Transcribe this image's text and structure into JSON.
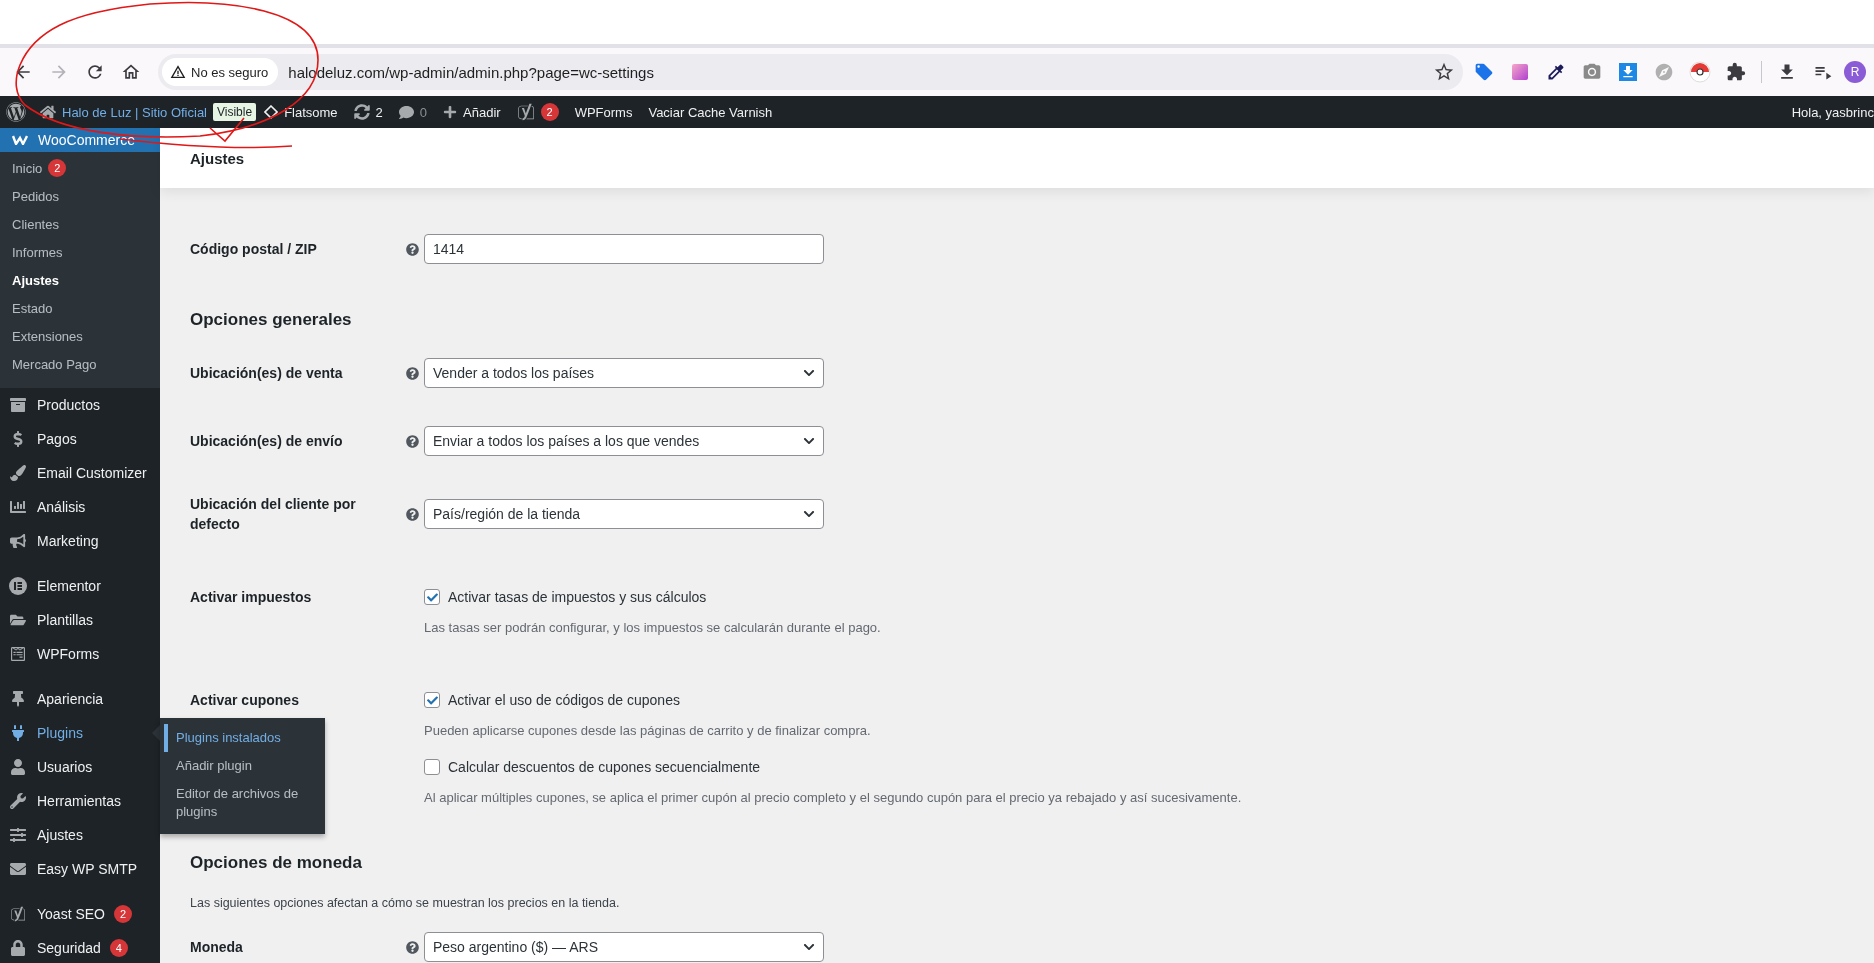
{
  "browser": {
    "back_disabled": false,
    "forward_disabled": true,
    "security_label": "No es seguro",
    "url": "halodeluz.com/wp-admin/admin.php?page=wc-settings",
    "profile_letter": "R"
  },
  "admin_bar": {
    "site_name": "Halo de Luz | Sitio Oficial",
    "visibility_badge": "Visible",
    "items": [
      {
        "kind": "theme",
        "label": "Flatsome"
      },
      {
        "kind": "updates",
        "label": "2"
      },
      {
        "kind": "comments",
        "label": "0"
      },
      {
        "kind": "new",
        "label": "Añadir"
      },
      {
        "kind": "seo",
        "badge": "2"
      },
      {
        "kind": "text",
        "label": "WPForms"
      },
      {
        "kind": "text",
        "label": "Vaciar Cache Varnish"
      }
    ],
    "greeting": "Hola, yasbrinc"
  },
  "sidebar": {
    "items": [
      {
        "kind": "woo",
        "label": "WooCommerce",
        "current": true,
        "children": [
          {
            "label": "Inicio",
            "badge": "2",
            "selected": false
          },
          {
            "label": "Pedidos",
            "selected": false
          },
          {
            "label": "Clientes",
            "selected": false
          },
          {
            "label": "Informes",
            "selected": false
          },
          {
            "label": "Ajustes",
            "selected": true
          },
          {
            "label": "Estado",
            "selected": false
          },
          {
            "label": "Extensiones",
            "selected": false
          },
          {
            "label": "Mercado Pago",
            "selected": false
          }
        ]
      },
      {
        "kind": "products",
        "label": "Productos"
      },
      {
        "kind": "payments",
        "label": "Pagos"
      },
      {
        "kind": "brush",
        "label": "Email Customizer"
      },
      {
        "kind": "analytics",
        "label": "Análisis"
      },
      {
        "kind": "marketing",
        "label": "Marketing"
      },
      {
        "kind": "elementor",
        "label": "Elementor",
        "separator_before": true
      },
      {
        "kind": "templates",
        "label": "Plantillas"
      },
      {
        "kind": "forms",
        "label": "WPForms"
      },
      {
        "kind": "appearance",
        "label": "Apariencia",
        "separator_before": true
      },
      {
        "kind": "plugins",
        "label": "Plugins",
        "hovered": true,
        "flyout": [
          {
            "label": "Plugins instalados",
            "selected": true
          },
          {
            "label": "Añadir plugin",
            "selected": false
          },
          {
            "label": "Editor de archivos de plugins",
            "selected": false
          }
        ]
      },
      {
        "kind": "users",
        "label": "Usuarios"
      },
      {
        "kind": "tools",
        "label": "Herramientas"
      },
      {
        "kind": "settings",
        "label": "Ajustes"
      },
      {
        "kind": "mail",
        "label": "Easy WP SMTP"
      },
      {
        "kind": "seo",
        "label": "Yoast SEO",
        "badge": "2",
        "separator_before": true
      },
      {
        "kind": "security",
        "label": "Seguridad",
        "badge": "4"
      }
    ]
  },
  "page": {
    "title": "Ajustes",
    "rows": [
      {
        "kind": "text",
        "label": "Código postal / ZIP",
        "help": true,
        "value": "1414"
      },
      {
        "kind": "heading",
        "label": "Opciones generales"
      },
      {
        "kind": "select",
        "label": "Ubicación(es) de venta",
        "help": true,
        "value": "Vender a todos los países"
      },
      {
        "kind": "select",
        "label": "Ubicación(es) de envío",
        "help": true,
        "value": "Enviar a todos los países a los que vendes"
      },
      {
        "kind": "select",
        "label": "Ubicación del cliente por defecto",
        "help": true,
        "value": "País/región de la tienda"
      },
      {
        "kind": "checkboxes",
        "label": "Activar impuestos",
        "options": [
          {
            "label": "Activar tasas de impuestos y sus cálculos",
            "checked": true,
            "description": "Las tasas ser podrán configurar, y los impuestos se calcularán durante el pago."
          }
        ]
      },
      {
        "kind": "checkboxes",
        "label": "Activar cupones",
        "options": [
          {
            "label": "Activar el uso de códigos de cupones",
            "checked": true,
            "description": "Pueden aplicarse cupones desde las páginas de carrito y de finalizar compra."
          },
          {
            "label": "Calcular descuentos de cupones secuencialmente",
            "checked": false,
            "description": "Al aplicar múltiples cupones, se aplica el primer cupón al precio completo y el segundo cupón para el precio ya rebajado y así sucesivamente."
          }
        ]
      },
      {
        "kind": "heading",
        "label": "Opciones de moneda",
        "description": "Las siguientes opciones afectan a cómo se muestran los precios en la tienda."
      },
      {
        "kind": "select",
        "label": "Moneda",
        "help": true,
        "value": "Peso argentino ($) — ARS"
      }
    ]
  }
}
